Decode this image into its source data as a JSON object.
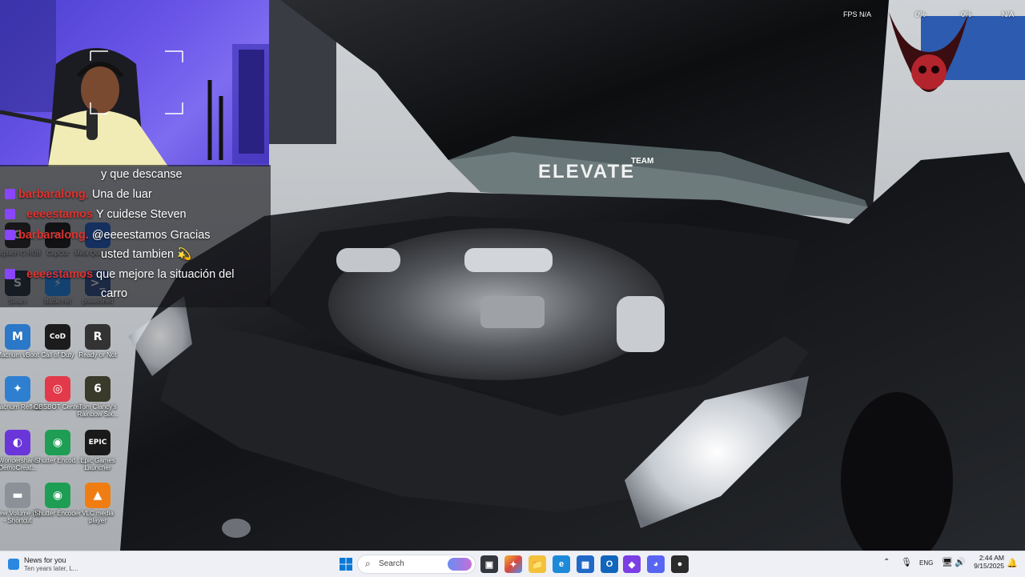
{
  "chat": {
    "messages": [
      {
        "user": "",
        "text": "y que descanse"
      },
      {
        "user": "barbaralong.",
        "text": "Una de luar"
      },
      {
        "user": "eeeestamos",
        "text": "Y cuidese Steven"
      },
      {
        "user": "barbaralong.",
        "text": "@eeeestamos Gracias usted tambien 💫",
        "line1": "@eeeestamos Gracias",
        "line2": "usted tambien 💫"
      },
      {
        "user": "eeeestamos",
        "text": "que mejore la situación del carro",
        "line1": "que mejore la situación del",
        "line2": "carro"
      }
    ]
  },
  "overlay": {
    "fps_label": "FPS",
    "fps_value": "N/A",
    "stat_a": "0%",
    "stat_b": "0%",
    "stat_c": "N/A"
  },
  "wallpaper": {
    "hood_text_top": "TEAM",
    "hood_text_main": "ELEVATE"
  },
  "desktop_icons": [
    {
      "label": "Logitech G HUB",
      "glyph": "G",
      "color": "#1d1d1d"
    },
    {
      "label": "CapCut",
      "glyph": "✂",
      "color": "#111111"
    },
    {
      "label": "Meta Quest Link",
      "glyph": "∞",
      "color": "#1a5fd1"
    },
    {
      "label": "Steam",
      "glyph": "S",
      "color": "#1b2838"
    },
    {
      "label": "Battle.net",
      "glyph": "⚡",
      "color": "#148eff"
    },
    {
      "label": "powershell",
      "glyph": ">_",
      "color": "#2a4d8f"
    },
    {
      "label": "Macrium vBoot",
      "glyph": "M",
      "color": "#2b77c8"
    },
    {
      "label": "Call of Duty",
      "glyph": "CoD",
      "color": "#1c1c1c"
    },
    {
      "label": "Ready or Not",
      "glyph": "R",
      "color": "#333333"
    },
    {
      "label": "Macrium Reflect",
      "glyph": "✦",
      "color": "#2f7fd0"
    },
    {
      "label": "OBSBOT Center",
      "glyph": "◎",
      "color": "#e23a4a"
    },
    {
      "label": "Tom Clancy's Rainbow Six...",
      "glyph": "6",
      "color": "#3a3a2a"
    },
    {
      "label": "Wondershare DemoCreat...",
      "glyph": "◐",
      "color": "#6a36d9"
    },
    {
      "label": "Shutter Encod...",
      "glyph": "◉",
      "color": "#1e9e54"
    },
    {
      "label": "Epic Games Launcher",
      "glyph": "EPIC",
      "color": "#1a1a1a"
    },
    {
      "label": "New Volume (F) - Shortcut",
      "glyph": "▬",
      "color": "#8c9198"
    },
    {
      "label": "Shutter Encoder",
      "glyph": "◉",
      "color": "#1e9e54"
    },
    {
      "label": "VLC media player",
      "glyph": "▲",
      "color": "#f07d12"
    }
  ],
  "taskbar": {
    "news_title": "News for you",
    "news_subtitle": "Ten years later, L...",
    "search_placeholder": "Search",
    "lang": "ENG",
    "time": "2:44 AM",
    "date": "9/15/2025",
    "apps": [
      {
        "name": "file-explorer",
        "glyph": "📁",
        "color": "#f3c13a"
      },
      {
        "name": "edge",
        "glyph": "e",
        "color": "#1d8ad9"
      },
      {
        "name": "store",
        "glyph": "▦",
        "color": "#2169c7"
      },
      {
        "name": "outlook",
        "glyph": "O",
        "color": "#1166bb"
      },
      {
        "name": "clipchamp",
        "glyph": "◆",
        "color": "#7b3fe4"
      },
      {
        "name": "discord",
        "glyph": "◕",
        "color": "#5865f2"
      },
      {
        "name": "obs",
        "glyph": "●",
        "color": "#2b2b2b"
      }
    ]
  }
}
